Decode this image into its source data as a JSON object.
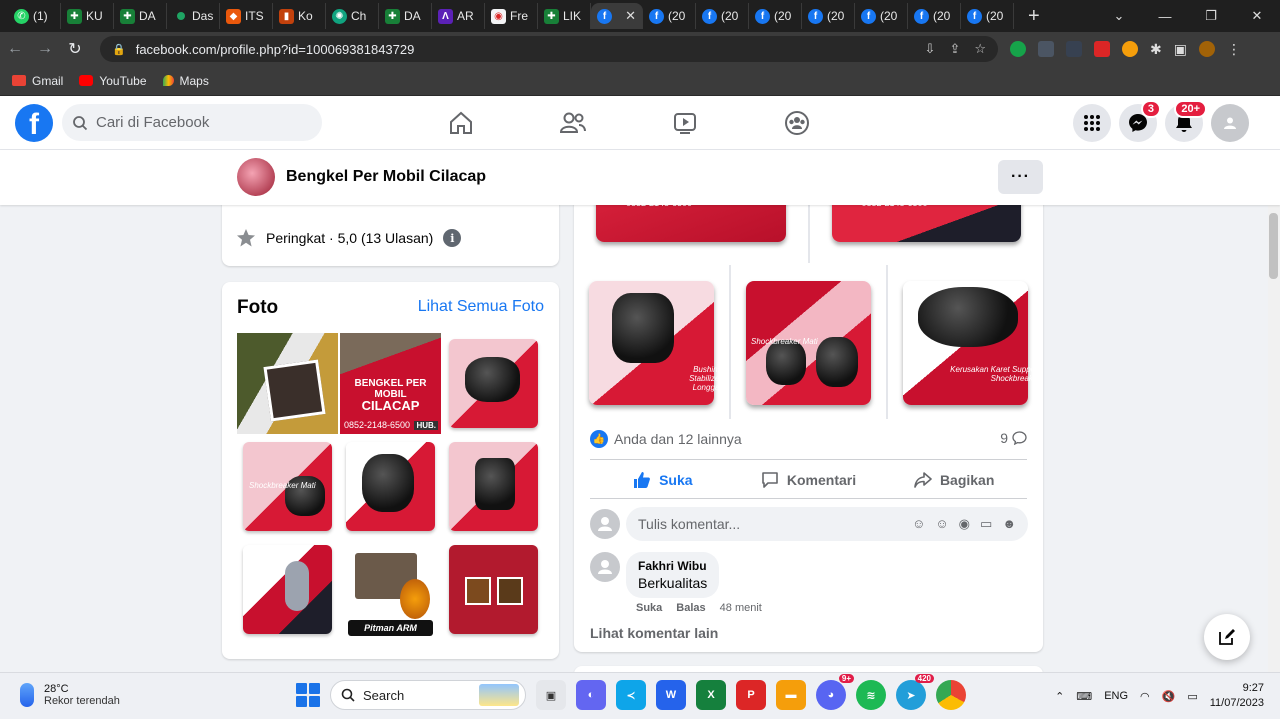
{
  "browser": {
    "tabs": [
      {
        "label": "(1)",
        "icon": "whatsapp-icon"
      },
      {
        "label": "KU",
        "icon": "sheets-icon"
      },
      {
        "label": "DA",
        "icon": "sheets-icon"
      },
      {
        "label": "Das",
        "icon": "dot-icon"
      },
      {
        "label": "ITS",
        "icon": "its-icon"
      },
      {
        "label": "Ko",
        "icon": "ko-icon"
      },
      {
        "label": "Ch",
        "icon": "chatgpt-icon"
      },
      {
        "label": "DA",
        "icon": "sheets-icon"
      },
      {
        "label": "AR",
        "icon": "ar-icon"
      },
      {
        "label": "Fre",
        "icon": "fre-icon"
      },
      {
        "label": "LIK",
        "icon": "sheets-icon"
      }
    ],
    "fb_tabs": [
      "(20",
      "(20",
      "(20",
      "(20",
      "(20",
      "(20",
      "(20"
    ],
    "url": "facebook.com/profile.php?id=100069381843729",
    "bookmarks": [
      "Gmail",
      "YouTube",
      "Maps"
    ]
  },
  "facebook": {
    "search_placeholder": "Cari di Facebook",
    "messenger_badge": "3",
    "notif_badge": "20+",
    "page_name": "Bengkel Per Mobil Cilacap",
    "rating_text": "Peringkat · 5,0 (13 Ulasan)",
    "photos": {
      "title": "Foto",
      "see_all": "Lihat Semua Foto",
      "thumb2_line1": "BENGKEL PER MOBIL",
      "thumb2_line2": "CILACAP",
      "thumb2_phone": "0852-2148-6500",
      "thumb2_hub": "HUB.",
      "thumb4_caption": "Shockbreaker Mati",
      "thumb8_caption": "Pitman ARM"
    },
    "post": {
      "top_phone": "0852-2148-6500",
      "tile1_caption": "Bushing Stabilizer Longgar",
      "tile2_caption": "Shockbreaker Mati",
      "tile3_caption": "Kerusakan Karet Support Shockbreaker",
      "reactions_text": "Anda dan 12 lainnya",
      "comment_count": "9",
      "like_label": "Suka",
      "comment_label": "Komentari",
      "share_label": "Bagikan",
      "comment_placeholder": "Tulis komentar...",
      "comment": {
        "author": "Fakhri Wibu",
        "text": "Berkualitas",
        "like": "Suka",
        "reply": "Balas",
        "time": "48 menit"
      },
      "more_comments": "Lihat komentar lain"
    }
  },
  "taskbar": {
    "temperature": "28°C",
    "weather_desc": "Rekor terendah",
    "search_label": "Search",
    "discord_badge": "9+",
    "telegram_badge": "420",
    "language": "ENG",
    "time": "9:27",
    "date": "11/07/2023"
  }
}
